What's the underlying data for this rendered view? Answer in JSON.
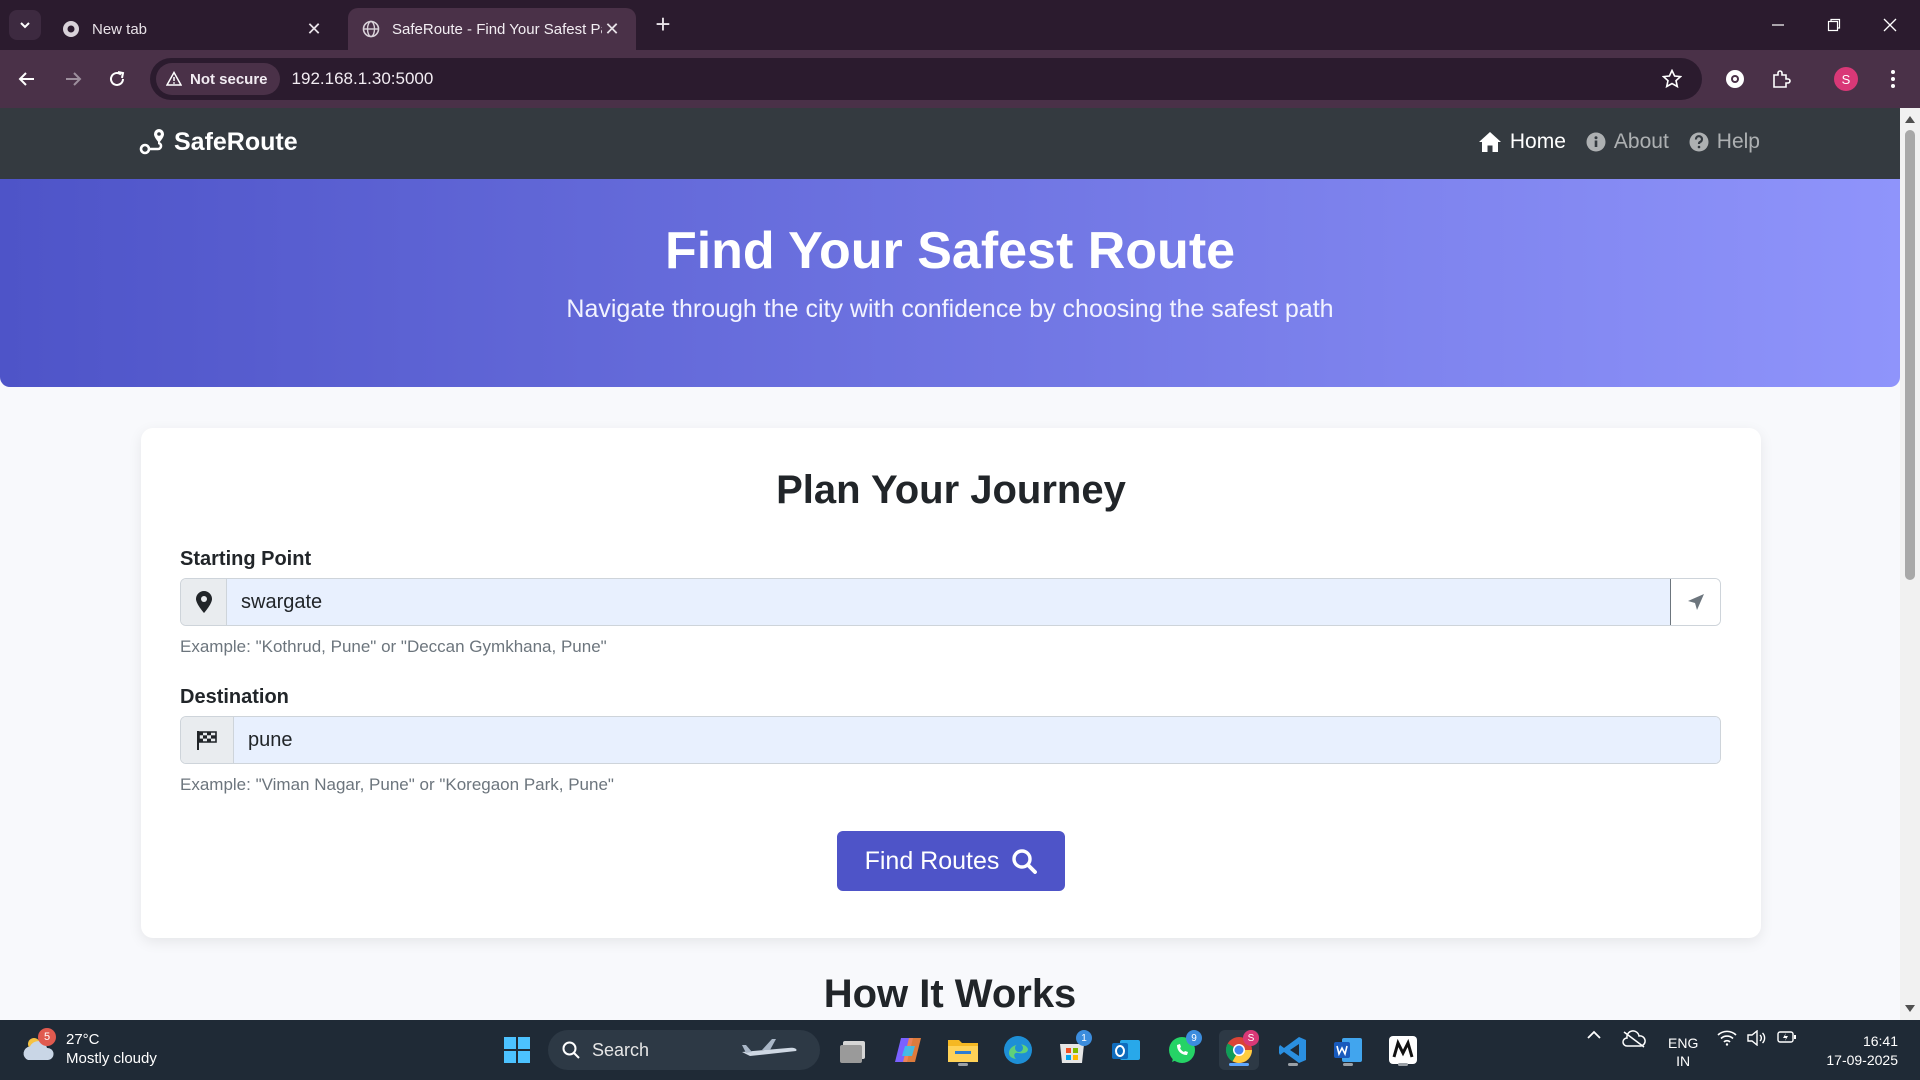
{
  "browser": {
    "tabs": [
      {
        "title": "New tab",
        "active": false
      },
      {
        "title": "SafeRoute - Find Your Safest Pa",
        "active": true
      }
    ],
    "security_label": "Not secure",
    "url": "192.168.1.30:5000",
    "profile_initial": "S"
  },
  "navbar": {
    "brand": "SafeRoute",
    "links": [
      {
        "label": "Home",
        "icon": "home-icon",
        "active": true
      },
      {
        "label": "About",
        "icon": "info-icon",
        "active": false
      },
      {
        "label": "Help",
        "icon": "question-icon",
        "active": false
      }
    ]
  },
  "hero": {
    "title": "Find Your Safest Route",
    "subtitle": "Navigate through the city with confidence by choosing the safest path"
  },
  "planner": {
    "title": "Plan Your Journey",
    "start_label": "Starting Point",
    "start_value": "swargate",
    "start_hint": "Example: \"Kothrud, Pune\" or \"Deccan Gymkhana, Pune\"",
    "dest_label": "Destination",
    "dest_value": "pune",
    "dest_hint": "Example: \"Viman Nagar, Pune\" or \"Koregaon Park, Pune\"",
    "find_button": "Find Routes"
  },
  "how_it_works": {
    "title": "How It Works"
  },
  "taskbar": {
    "weather_temp": "27°C",
    "weather_desc": "Mostly cloudy",
    "weather_badge": "5",
    "search_label": "Search",
    "store_badge": "1",
    "whatsapp_badge": "9",
    "chrome_badge": "S",
    "lang_line1": "ENG",
    "lang_line2": "IN",
    "time": "16:41",
    "date": "17-09-2025"
  },
  "colors": {
    "accent": "#4e54c8",
    "hero_gradient_end": "#8f94fb",
    "navbar": "#343a40",
    "browser_frame": "#2b1b2e",
    "browser_toolbar": "#4a3148"
  }
}
